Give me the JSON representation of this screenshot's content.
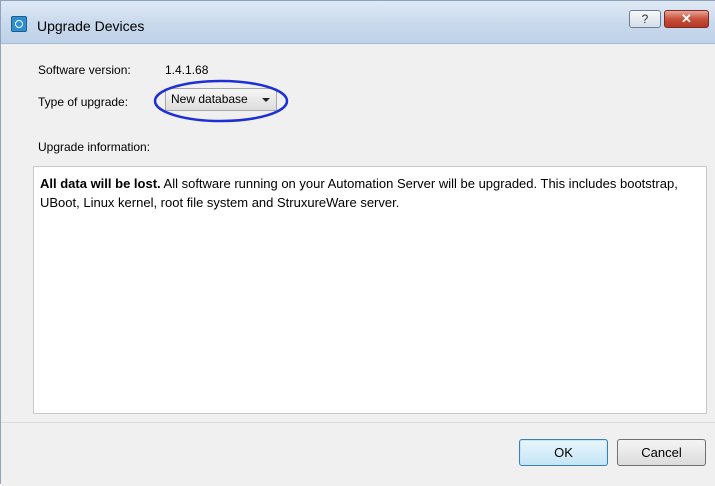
{
  "window": {
    "title": "Upgrade Devices",
    "help_label": "?",
    "close_label": "✕"
  },
  "form": {
    "software_version_label": "Software version:",
    "software_version_value": "1.4.1.68",
    "upgrade_type_label": "Type of upgrade:",
    "upgrade_type_value": "New database",
    "upgrade_info_label": "Upgrade information:"
  },
  "info": {
    "bold_text": "All data will be lost.",
    "text": " All software running on your Automation Server will be upgraded. This includes bootstrap, UBoot, Linux kernel, root file system and StruxureWare server."
  },
  "buttons": {
    "ok_label": "OK",
    "cancel_label": "Cancel"
  },
  "colors": {
    "annotation_circle": "#1f2fd6",
    "title_bar": "#c9d9ec",
    "close_button": "#c8503c"
  }
}
